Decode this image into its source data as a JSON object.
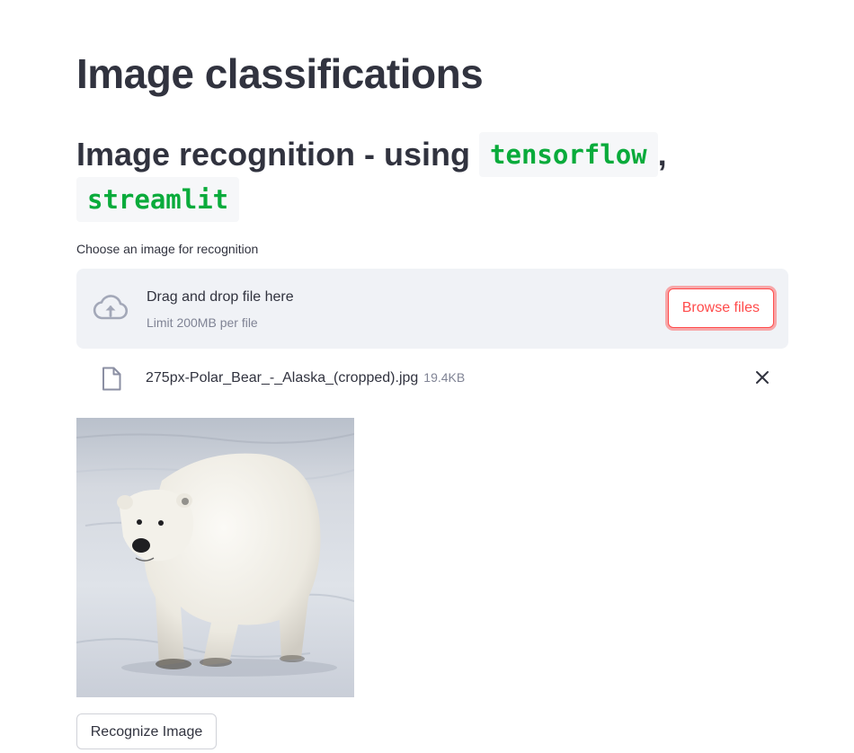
{
  "page": {
    "title": "Image classifications",
    "subtitle": {
      "prefix": "Image recognition - using",
      "code_1": "tensorflow",
      "separator": ",",
      "code_2": "streamlit"
    }
  },
  "uploader": {
    "label": "Choose an image for recognition",
    "drop_text": "Drag and drop file here",
    "limit_text": "Limit 200MB per file",
    "browse_label": "Browse files",
    "cloud_icon": "cloud-upload-icon",
    "file": {
      "name": "275px-Polar_Bear_-_Alaska_(cropped).jpg",
      "size": "19.4KB",
      "icon": "file-icon",
      "remove_icon": "close-icon"
    }
  },
  "preview": {
    "subject": "polar-bear-image"
  },
  "actions": {
    "recognize_label": "Recognize Image"
  },
  "colors": {
    "text": "#31333f",
    "muted": "#808495",
    "accent": "#ff4b4b",
    "code_green": "#09ab3b",
    "dropzone_bg": "#f0f2f6"
  }
}
